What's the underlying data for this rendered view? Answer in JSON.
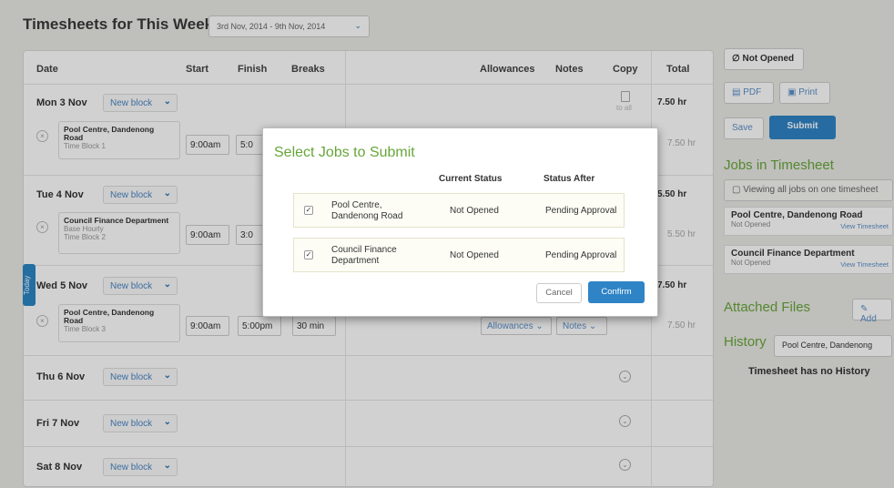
{
  "header": {
    "title": "Timesheets for This Week",
    "week": "3rd Nov, 2014 - 9th Nov, 2014"
  },
  "columns": {
    "date": "Date",
    "start": "Start",
    "finish": "Finish",
    "breaks": "Breaks",
    "allowances": "Allowances",
    "notes": "Notes",
    "copy": "Copy",
    "total": "Total"
  },
  "days": [
    {
      "label": "Mon 3 Nov",
      "new_block": "New block",
      "total": "7.50 hr"
    },
    {
      "label": "Tue 4 Nov",
      "new_block": "New block",
      "total": "5.50 hr"
    },
    {
      "label": "Wed 5 Nov",
      "new_block": "New block",
      "total": "7.50 hr"
    },
    {
      "label": "Thu 6 Nov",
      "new_block": "New block"
    },
    {
      "label": "Fri 7 Nov",
      "new_block": "New block"
    },
    {
      "label": "Sat 8 Nov",
      "new_block": "New block"
    }
  ],
  "blocks": [
    {
      "job": "Pool Centre, Dandenong Road",
      "sub": "Time Block 1",
      "start": "9:00am",
      "finish": "5:0",
      "total": "7.50 hr"
    },
    {
      "job": "Council Finance Department",
      "sub1": "Base Hourly",
      "sub2": "Time Block 2",
      "start": "9:00am",
      "finish": "3:0",
      "total": "5.50 hr"
    },
    {
      "job": "Pool Centre, Dandenong Road",
      "sub": "Time Block 3",
      "start": "9:00am",
      "finish": "5:00pm",
      "breaks": "30 min",
      "allowances": "Allowances",
      "notes": "Notes",
      "total": "7.50 hr"
    }
  ],
  "copy_to_all": "to all",
  "today_tab": "Today",
  "modal": {
    "title": "Select Jobs to Submit",
    "col_current": "Current Status",
    "col_after": "Status After",
    "rows": [
      {
        "job_line1": "Pool Centre,",
        "job_line2": "Dandenong Road",
        "current": "Not Opened",
        "after": "Pending Approval"
      },
      {
        "job_line1": "Council Finance",
        "job_line2": "Department",
        "current": "Not Opened",
        "after": "Pending Approval"
      }
    ],
    "cancel": "Cancel",
    "confirm": "Confirm"
  },
  "sidebar": {
    "status": "Not Opened",
    "pdf": "PDF",
    "print": "Print",
    "save": "Save",
    "submit": "Submit",
    "jobs_title": "Jobs in Timesheet",
    "viewing_all": "Viewing all jobs on one timesheet",
    "jobs": [
      {
        "name": "Pool Centre, Dandenong Road",
        "status": "Not Opened",
        "link": "View Timesheet"
      },
      {
        "name": "Council Finance Department",
        "status": "Not Opened",
        "link": "View Timesheet"
      }
    ],
    "attached_title": "Attached Files",
    "add": "Add",
    "history_title": "History",
    "history_select": "Pool Centre, Dandenong",
    "history_empty": "Timesheet has no History"
  },
  "colors": {
    "accent_green": "#67a63a",
    "primary_blue": "#2f84c6"
  }
}
